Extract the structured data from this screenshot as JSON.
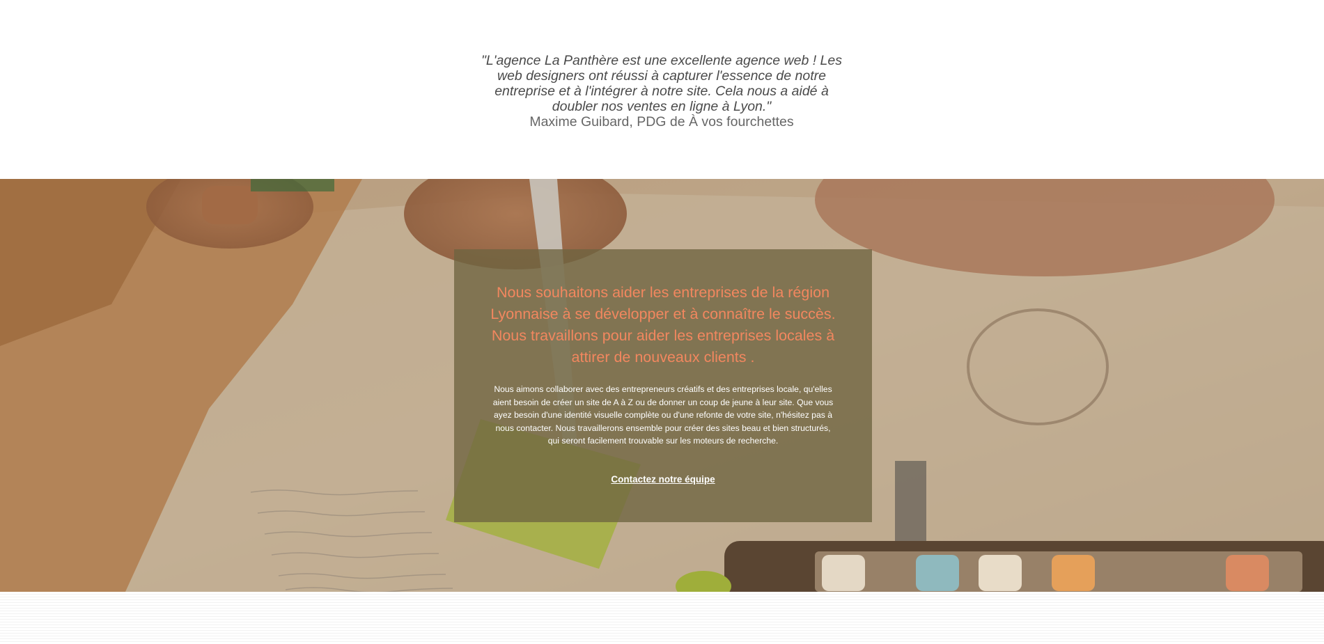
{
  "testimonial": {
    "quote": "\"L'agence La Panthère est une excellente agence web ! Les web designers ont réussi à capturer l'essence de notre entreprise et à l'intégrer à notre site. Cela nous a aidé à doubler nos ventes en ligne à Lyon.\"",
    "author": "Maxime Guibard, PDG de À vos fourchettes"
  },
  "hero": {
    "headline": "Nous souhaitons aider les entreprises de la région Lyonnaise à se développer et à connaître le succès. Nous travaillons pour aider les entreprises locales à attirer de nouveaux clients .",
    "body": "Nous aimons collaborer avec des entrepreneurs créatifs et des entreprises locale, qu'elles aient besoin de créer un site de A à Z ou de donner un coup de jeune à leur site. Que vous ayez besoin d'une identité visuelle complète ou d'une refonte de votre site, n'hésitez pas à nous contacter. Nous travaillerons ensemble pour créer des sites beau et bien structurés, qui seront facilement trouvable sur les moteurs de recherche.",
    "cta_label": "Contactez notre équipe"
  },
  "colors": {
    "headline": "#f2875f",
    "overlay": "#6e6440",
    "quote_text": "#4a4a4a",
    "author_text": "#666666",
    "body_text": "#ffffff"
  }
}
